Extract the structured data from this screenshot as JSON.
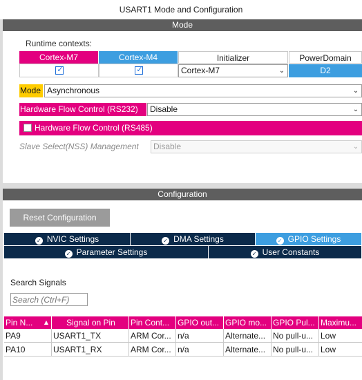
{
  "window": {
    "title": "USART1 Mode and Configuration"
  },
  "mode_section": {
    "title": "Mode",
    "runtime_contexts_label": "Runtime contexts:",
    "contexts": [
      {
        "label": "Cortex-M7",
        "checked": true
      },
      {
        "label": "Cortex-M4",
        "checked": true
      }
    ],
    "initializer": {
      "header": "Initializer",
      "value": "Cortex-M7"
    },
    "power_domain": {
      "header": "PowerDomain",
      "value": "D2"
    },
    "mode": {
      "label": "Mode",
      "value": "Asynchronous"
    },
    "hw_flow_rs232": {
      "label": "Hardware Flow Control (RS232)",
      "value": "Disable"
    },
    "hw_flow_rs485": {
      "label": "Hardware Flow Control (RS485)",
      "checked": false
    },
    "slave_select": {
      "label": "Slave Select(NSS) Management",
      "value": "Disable"
    }
  },
  "config_section": {
    "title": "Configuration",
    "reset_button": "Reset Configuration",
    "tabs_row1": [
      {
        "label": "NVIC Settings",
        "active": false
      },
      {
        "label": "DMA Settings",
        "active": false
      },
      {
        "label": "GPIO Settings",
        "active": true
      }
    ],
    "tabs_row2": [
      {
        "label": "Parameter Settings",
        "active": false
      },
      {
        "label": "User Constants",
        "active": false
      }
    ],
    "search": {
      "label": "Search Signals",
      "placeholder": "Search (Ctrl+F)"
    },
    "table": {
      "columns": [
        "Pin N...",
        "Signal on Pin",
        "Pin Cont...",
        "GPIO out...",
        "GPIO mo...",
        "GPIO Pul...",
        "Maximu..."
      ],
      "rows": [
        [
          "PA9",
          "USART1_TX",
          "ARM Cor...",
          "n/a",
          "Alternate...",
          "No pull-u...",
          "Low"
        ],
        [
          "PA10",
          "USART1_RX",
          "ARM Cor...",
          "n/a",
          "Alternate...",
          "No pull-u...",
          "Low"
        ]
      ]
    }
  },
  "colors": {
    "pink": "#e3007f",
    "blue": "#3d9ee0",
    "navy": "#0b2a4a",
    "yellow": "#ffcc00",
    "grey_bar": "#5e5e5e"
  },
  "icons": {
    "dropdown": "chevron-down-icon",
    "checkmark": "check-icon",
    "tab_status": "check-circle-icon",
    "sort": "sort-ascending-icon"
  }
}
